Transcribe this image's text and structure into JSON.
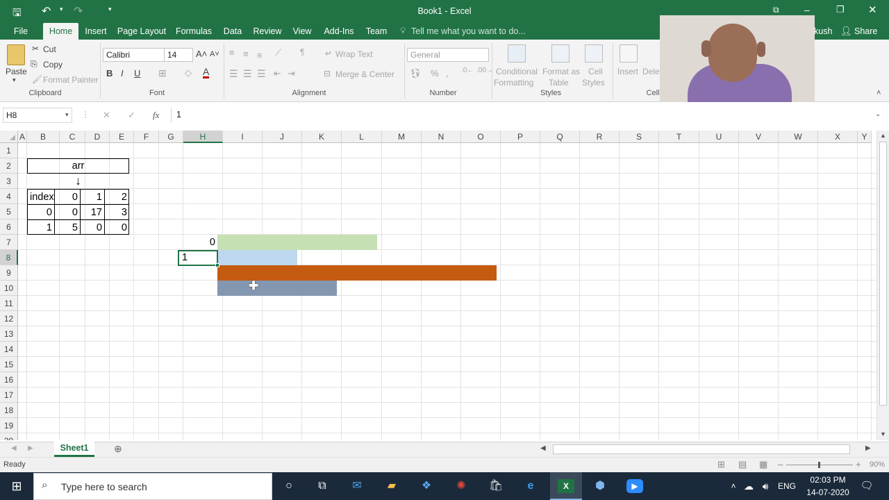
{
  "window": {
    "title": "Book1 - Excel"
  },
  "tabs": [
    {
      "label": "File"
    },
    {
      "label": "Home"
    },
    {
      "label": "Insert"
    },
    {
      "label": "Page Layout"
    },
    {
      "label": "Formulas"
    },
    {
      "label": "Data"
    },
    {
      "label": "Review"
    },
    {
      "label": "View"
    },
    {
      "label": "Add-Ins"
    },
    {
      "label": "Team"
    }
  ],
  "tell_me": "Tell me what you want to do...",
  "user_partial": "kush",
  "share": "Share",
  "ribbon": {
    "clipboard": {
      "paste": "Paste",
      "cut": "Cut",
      "copy": "Copy",
      "format_painter": "Format Painter",
      "group": "Clipboard"
    },
    "font": {
      "name": "Calibri",
      "size": "14",
      "bold": "B",
      "italic": "I",
      "underline": "U",
      "group": "Font"
    },
    "alignment": {
      "wrap": "Wrap Text",
      "merge": "Merge & Center",
      "group": "Alignment"
    },
    "number": {
      "format": "General",
      "group": "Number"
    },
    "styles": {
      "conditional": "Conditional",
      "conditional2": "Formatting",
      "format_table": "Format as",
      "format_table2": "Table",
      "cell_styles": "Cell",
      "cell_styles2": "Styles",
      "group": "Styles"
    },
    "cells": {
      "insert": "Insert",
      "delete": "Dele",
      "group": "Cell"
    }
  },
  "formula": {
    "name_box": "H8",
    "fx": "fx",
    "value": "1"
  },
  "columns": [
    "A",
    "B",
    "C",
    "D",
    "E",
    "F",
    "G",
    "H",
    "I",
    "J",
    "K",
    "L",
    "M",
    "N",
    "O",
    "P",
    "Q",
    "R",
    "S",
    "T",
    "U",
    "V",
    "W",
    "X",
    "Y"
  ],
  "rows": [
    "1",
    "2",
    "3",
    "4",
    "5",
    "6",
    "7",
    "8",
    "9",
    "10",
    "11",
    "12",
    "13",
    "14",
    "15",
    "16",
    "17",
    "18",
    "19",
    "20"
  ],
  "sheet": {
    "arr_label": "arr",
    "arrow": "↓",
    "table": [
      [
        "index",
        "0",
        "1",
        "2"
      ],
      [
        "0",
        "0",
        "17",
        "3"
      ],
      [
        "1",
        "5",
        "0",
        "0"
      ]
    ],
    "h7": "0",
    "h8": "1"
  },
  "colors": {
    "green_bar": "#c6e0b4",
    "blue_bar": "#bdd7ee",
    "orange_bar": "#c55a11",
    "slate_bar": "#8497b0",
    "excel_green": "#217346"
  },
  "sheet_tab": "Sheet1",
  "status": {
    "ready": "Ready",
    "zoom": "90%"
  },
  "taskbar": {
    "search": "Type here to search",
    "lang": "ENG",
    "time": "02:03 PM",
    "date": "14-07-2020"
  }
}
